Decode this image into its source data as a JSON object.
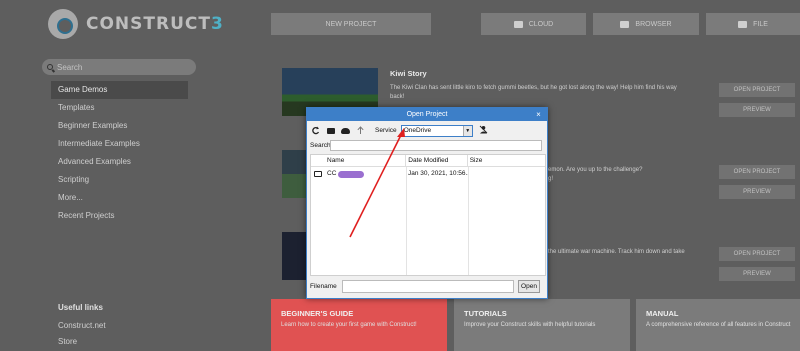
{
  "app": {
    "logo_text": "CONSTRUCT",
    "logo_number": "3"
  },
  "top_buttons": {
    "new_project": "NEW PROJECT",
    "cloud": "CLOUD",
    "browser": "BROWSER",
    "file": "FILE"
  },
  "sidebar": {
    "search_placeholder": "Search",
    "items": [
      {
        "label": "Game Demos",
        "active": true
      },
      {
        "label": "Templates"
      },
      {
        "label": "Beginner Examples"
      },
      {
        "label": "Intermediate Examples"
      },
      {
        "label": "Advanced Examples"
      },
      {
        "label": "Scripting"
      },
      {
        "label": "More..."
      },
      {
        "label": "Recent Projects"
      }
    ],
    "useful_links_title": "Useful links",
    "useful_links": [
      "Construct.net",
      "Store"
    ]
  },
  "demos": [
    {
      "title": "Kiwi Story",
      "desc_line1": "The Kiwi Clan has sent little kiro to fetch gummi beetles, but he got lost along the way! Help him find his way",
      "desc_line2": "back!"
    },
    {
      "title": "",
      "desc_line1": "emon. Are you up to the challenge?",
      "desc_line2": "g!"
    },
    {
      "title": "",
      "desc_line1": "the ultimate war machine. Track him down and take",
      "desc_line2": ""
    }
  ],
  "demo_buttons": {
    "open_project": "OPEN PROJECT",
    "preview": "PREVIEW"
  },
  "cards": [
    {
      "title": "BEGINNER'S GUIDE",
      "desc": "Learn how to create your first game with Construct!",
      "color": "#e05252"
    },
    {
      "title": "TUTORIALS",
      "desc": "Improve your Construct skills with helpful tutorials",
      "color": "#7b7b7b"
    },
    {
      "title": "MANUAL",
      "desc": "A comprehensive reference of all features in Construct",
      "color": "#7b7b7b"
    }
  ],
  "dialog": {
    "title": "Open Project",
    "close": "×",
    "service_label": "Service",
    "service_value": "OneDrive",
    "search_label": "Search",
    "columns": [
      "Name",
      "Date Modified",
      "Size"
    ],
    "rows": [
      {
        "name": "CC",
        "date": "Jan 30, 2021, 10:56..."
      }
    ],
    "filename_label": "Filename",
    "open_button": "Open"
  },
  "colors": {
    "accent": "#3d7fc8",
    "annotation": "#e02020"
  }
}
